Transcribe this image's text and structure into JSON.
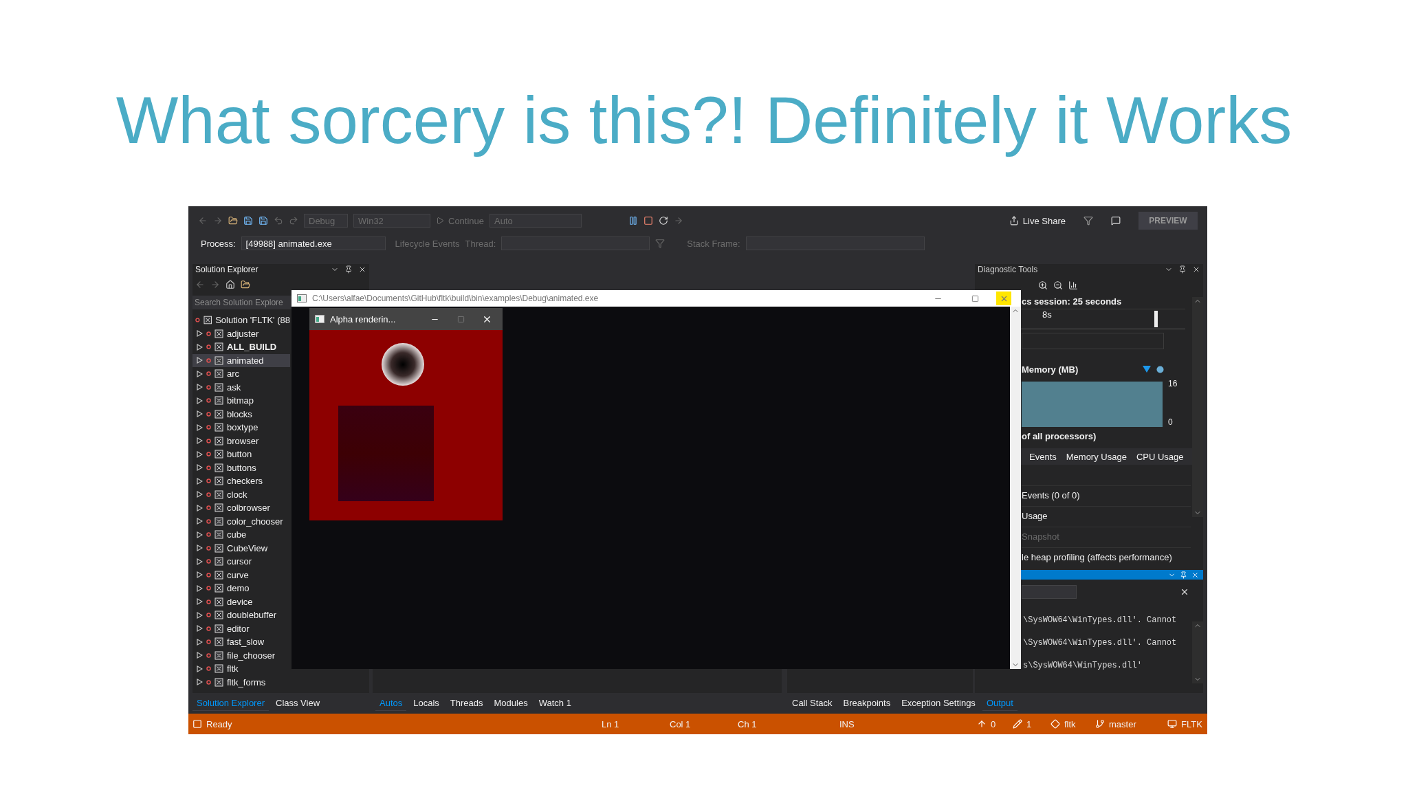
{
  "slide": {
    "title": "What sorcery is this?! Definitely it Works"
  },
  "toolbar": {
    "configuration": "Debug",
    "platform": "Win32",
    "continue": "Continue",
    "stack_mode": "Auto",
    "live_share": "Live Share",
    "preview": "PREVIEW"
  },
  "debug_location": {
    "process_label": "Process:",
    "process": "[49988] animated.exe",
    "lifecycle": "Lifecycle Events",
    "thread_label": "Thread:",
    "stack_frame_label": "Stack Frame:"
  },
  "solution_explorer": {
    "title": "Solution Explorer",
    "search_placeholder": "Search Solution Explore",
    "root": "Solution 'FLTK' (88",
    "items": [
      {
        "label": "adjuster",
        "bold": false,
        "selected": false
      },
      {
        "label": "ALL_BUILD",
        "bold": true,
        "selected": false
      },
      {
        "label": "animated",
        "bold": false,
        "selected": true
      },
      {
        "label": "arc",
        "bold": false,
        "selected": false
      },
      {
        "label": "ask",
        "bold": false,
        "selected": false
      },
      {
        "label": "bitmap",
        "bold": false,
        "selected": false
      },
      {
        "label": "blocks",
        "bold": false,
        "selected": false
      },
      {
        "label": "boxtype",
        "bold": false,
        "selected": false
      },
      {
        "label": "browser",
        "bold": false,
        "selected": false
      },
      {
        "label": "button",
        "bold": false,
        "selected": false
      },
      {
        "label": "buttons",
        "bold": false,
        "selected": false
      },
      {
        "label": "checkers",
        "bold": false,
        "selected": false
      },
      {
        "label": "clock",
        "bold": false,
        "selected": false
      },
      {
        "label": "colbrowser",
        "bold": false,
        "selected": false
      },
      {
        "label": "color_chooser",
        "bold": false,
        "selected": false
      },
      {
        "label": "cube",
        "bold": false,
        "selected": false
      },
      {
        "label": "CubeView",
        "bold": false,
        "selected": false
      },
      {
        "label": "cursor",
        "bold": false,
        "selected": false
      },
      {
        "label": "curve",
        "bold": false,
        "selected": false
      },
      {
        "label": "demo",
        "bold": false,
        "selected": false
      },
      {
        "label": "device",
        "bold": false,
        "selected": false
      },
      {
        "label": "doublebuffer",
        "bold": false,
        "selected": false
      },
      {
        "label": "editor",
        "bold": false,
        "selected": false
      },
      {
        "label": "fast_slow",
        "bold": false,
        "selected": false
      },
      {
        "label": "file_chooser",
        "bold": false,
        "selected": false
      },
      {
        "label": "fltk",
        "bold": false,
        "selected": false
      },
      {
        "label": "fltk_forms",
        "bold": false,
        "selected": false
      }
    ]
  },
  "diagnostic_tools": {
    "title": "Diagnostic Tools",
    "session": "cs session: 25 seconds",
    "timeline_tick": "8s",
    "memory_title": "Memory (MB)",
    "memory_max": "16",
    "memory_min": "0",
    "cpu_title": "of all processors)",
    "tabs": [
      {
        "label": "Events",
        "selected": false
      },
      {
        "label": "Memory Usage",
        "selected": false
      },
      {
        "label": "CPU Usage",
        "selected": false
      }
    ],
    "rows": [
      {
        "label": "Events (0 of 0)",
        "disabled": false
      },
      {
        "label": "Usage",
        "disabled": false
      },
      {
        "label": "Snapshot",
        "disabled": true
      },
      {
        "label": "le heap profiling (affects performance)",
        "disabled": false
      }
    ]
  },
  "output": {
    "lines": [
      "\\SysWOW64\\WinTypes.dll'. Cannot",
      "\\SysWOW64\\WinTypes.dll'. Cannot",
      "s\\SysWOW64\\WinTypes.dll'"
    ]
  },
  "bottom_tabs_left": [
    {
      "label": "Solution Explorer",
      "selected": true
    },
    {
      "label": "Class View",
      "selected": false
    }
  ],
  "bottom_tabs_middle": [
    {
      "label": "Autos",
      "selected": true
    },
    {
      "label": "Locals",
      "selected": false
    },
    {
      "label": "Threads",
      "selected": false
    },
    {
      "label": "Modules",
      "selected": false
    },
    {
      "label": "Watch 1",
      "selected": false
    }
  ],
  "bottom_tabs_right": [
    {
      "label": "Call Stack",
      "selected": false
    },
    {
      "label": "Breakpoints",
      "selected": false
    },
    {
      "label": "Exception Settings",
      "selected": false
    },
    {
      "label": "Output",
      "selected": true
    }
  ],
  "status_bar": {
    "state": "Ready",
    "line": "Ln 1",
    "column": "Col 1",
    "char": "Ch 1",
    "mode": "INS",
    "pushes": "0",
    "changes": "1",
    "repo": "fltk",
    "branch": "master",
    "solution": "FLTK"
  },
  "console_window": {
    "title": "C:\\Users\\alfae\\Documents\\GitHub\\fltk\\build\\bin\\examples\\Debug\\animated.exe"
  },
  "alpha_window": {
    "title": "Alpha renderin..."
  }
}
